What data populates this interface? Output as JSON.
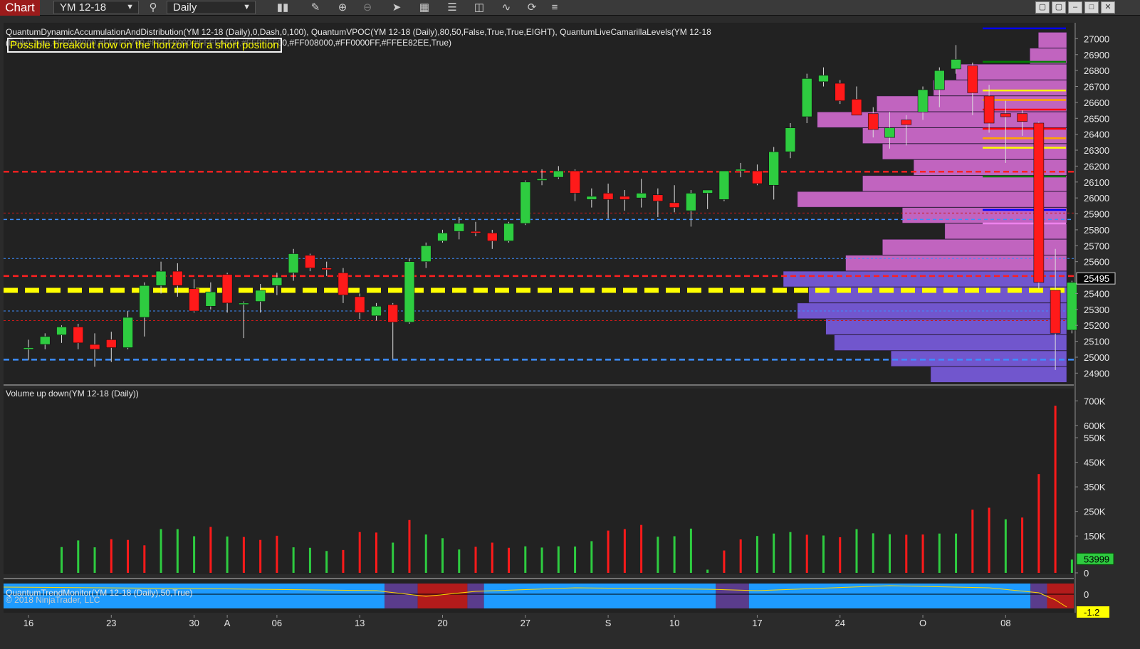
{
  "toolbar": {
    "brand": "Chart",
    "instrument": "YM 12-18",
    "period": "Daily"
  },
  "captions": {
    "price_indicators": "QuantumDynamicAccumulationAndDistribution(YM 12-18 (Daily),0,Dash,0,100), QuantumVPOC(YM 12-18 (Daily),80,50,False,True,True,EIGHT), QuantumLiveCamarillaLevels(YM 12-18",
    "price_indicators_2": "(Daily),True,#FF008000,#FFFFD700,#FFFF0000,#FFFFA500,#FFFFFF00,#FF008000,#FF0000FF,#FFEE82EE,True)",
    "banner": "Possible breakout now on the horizon for a short position",
    "volume_panel": "Volume up down(YM 12-18 (Daily))",
    "trend_panel": "QuantumTrendMonitor(YM 12-18 (Daily),50,True)",
    "copyright": "© 2018 NinjaTrader, LLC"
  },
  "colors": {
    "background": "#222222",
    "up": "#2ecc40",
    "down": "#ff1a1a",
    "vpoc_upper": "#d36bd0",
    "vpoc_lower": "#7a5ce0",
    "support_yellow": "#ffff00",
    "trend_blue": "#1e9bff",
    "trend_purple": "#5a3c8c",
    "trend_red": "#b31b1b"
  },
  "chart_data": {
    "type": "candlestick",
    "instrument": "YM 12-18",
    "timeframe": "Daily",
    "ylim": [
      24830,
      27100
    ],
    "y_ticks": [
      27000,
      26900,
      26800,
      26700,
      26600,
      26500,
      26400,
      26300,
      26200,
      26100,
      26000,
      25900,
      25800,
      25700,
      25600,
      25400,
      25300,
      25200,
      25100,
      25000,
      24900
    ],
    "x_ticks": [
      "16",
      "23",
      "30",
      "A",
      "06",
      "13",
      "20",
      "27",
      "S",
      "10",
      "17",
      "24",
      "O",
      "08"
    ],
    "x_tick_bars": [
      0,
      5,
      10,
      12,
      15,
      20,
      25,
      30,
      35,
      39,
      44,
      49,
      54,
      59
    ],
    "last_price": 25495,
    "candles": [
      {
        "o": 25050,
        "h": 25110,
        "l": 24980,
        "c": 25060
      },
      {
        "o": 25080,
        "h": 25150,
        "l": 25050,
        "c": 25130
      },
      {
        "o": 25140,
        "h": 25200,
        "l": 25090,
        "c": 25190
      },
      {
        "o": 25190,
        "h": 25210,
        "l": 25050,
        "c": 25090
      },
      {
        "o": 25080,
        "h": 25150,
        "l": 24940,
        "c": 25050
      },
      {
        "o": 25110,
        "h": 25160,
        "l": 24970,
        "c": 25060
      },
      {
        "o": 25060,
        "h": 25290,
        "l": 25050,
        "c": 25250
      },
      {
        "o": 25250,
        "h": 25470,
        "l": 25130,
        "c": 25450
      },
      {
        "o": 25450,
        "h": 25600,
        "l": 25400,
        "c": 25540
      },
      {
        "o": 25540,
        "h": 25590,
        "l": 25380,
        "c": 25450
      },
      {
        "o": 25430,
        "h": 25490,
        "l": 25280,
        "c": 25290
      },
      {
        "o": 25320,
        "h": 25470,
        "l": 25300,
        "c": 25410
      },
      {
        "o": 25520,
        "h": 25530,
        "l": 25280,
        "c": 25340
      },
      {
        "o": 25340,
        "h": 25350,
        "l": 25120,
        "c": 25340
      },
      {
        "o": 25350,
        "h": 25460,
        "l": 25280,
        "c": 25420
      },
      {
        "o": 25450,
        "h": 25530,
        "l": 25390,
        "c": 25500
      },
      {
        "o": 25530,
        "h": 25680,
        "l": 25480,
        "c": 25650
      },
      {
        "o": 25640,
        "h": 25650,
        "l": 25540,
        "c": 25560
      },
      {
        "o": 25560,
        "h": 25600,
        "l": 25510,
        "c": 25550
      },
      {
        "o": 25530,
        "h": 25560,
        "l": 25340,
        "c": 25390
      },
      {
        "o": 25380,
        "h": 25400,
        "l": 25240,
        "c": 25280
      },
      {
        "o": 25260,
        "h": 25340,
        "l": 25230,
        "c": 25320
      },
      {
        "o": 25330,
        "h": 25340,
        "l": 24990,
        "c": 25220
      },
      {
        "o": 25220,
        "h": 25620,
        "l": 25210,
        "c": 25600
      },
      {
        "o": 25600,
        "h": 25720,
        "l": 25560,
        "c": 25700
      },
      {
        "o": 25730,
        "h": 25800,
        "l": 25720,
        "c": 25780
      },
      {
        "o": 25790,
        "h": 25880,
        "l": 25740,
        "c": 25840
      },
      {
        "o": 25790,
        "h": 25850,
        "l": 25760,
        "c": 25780
      },
      {
        "o": 25780,
        "h": 25800,
        "l": 25680,
        "c": 25730
      },
      {
        "o": 25730,
        "h": 25850,
        "l": 25720,
        "c": 25840
      },
      {
        "o": 25840,
        "h": 26110,
        "l": 25830,
        "c": 26100
      },
      {
        "o": 26110,
        "h": 26180,
        "l": 26080,
        "c": 26120
      },
      {
        "o": 26130,
        "h": 26200,
        "l": 26120,
        "c": 26170
      },
      {
        "o": 26170,
        "h": 26180,
        "l": 25980,
        "c": 26030
      },
      {
        "o": 25990,
        "h": 26060,
        "l": 25940,
        "c": 26010
      },
      {
        "o": 26030,
        "h": 26090,
        "l": 25870,
        "c": 25990
      },
      {
        "o": 26010,
        "h": 26050,
        "l": 25920,
        "c": 25990
      },
      {
        "o": 26000,
        "h": 26120,
        "l": 25940,
        "c": 26030
      },
      {
        "o": 26020,
        "h": 26060,
        "l": 25880,
        "c": 25980
      },
      {
        "o": 25970,
        "h": 26080,
        "l": 25910,
        "c": 25940
      },
      {
        "o": 25920,
        "h": 26050,
        "l": 25820,
        "c": 26030
      },
      {
        "o": 26030,
        "h": 26050,
        "l": 25930,
        "c": 26050
      },
      {
        "o": 25990,
        "h": 26170,
        "l": 25980,
        "c": 26170
      },
      {
        "o": 26170,
        "h": 26220,
        "l": 26130,
        "c": 26180
      },
      {
        "o": 26170,
        "h": 26210,
        "l": 26080,
        "c": 26090
      },
      {
        "o": 26080,
        "h": 26320,
        "l": 25990,
        "c": 26290
      },
      {
        "o": 26290,
        "h": 26470,
        "l": 26250,
        "c": 26440
      },
      {
        "o": 26510,
        "h": 26780,
        "l": 26470,
        "c": 26750
      },
      {
        "o": 26730,
        "h": 26820,
        "l": 26700,
        "c": 26770
      },
      {
        "o": 26720,
        "h": 26740,
        "l": 26590,
        "c": 26610
      },
      {
        "o": 26620,
        "h": 26700,
        "l": 26520,
        "c": 26520
      },
      {
        "o": 26530,
        "h": 26570,
        "l": 26380,
        "c": 26430
      },
      {
        "o": 26380,
        "h": 26540,
        "l": 26310,
        "c": 26440
      },
      {
        "o": 26490,
        "h": 26520,
        "l": 26330,
        "c": 26460
      },
      {
        "o": 26540,
        "h": 26700,
        "l": 26490,
        "c": 26680
      },
      {
        "o": 26680,
        "h": 26820,
        "l": 26570,
        "c": 26800
      },
      {
        "o": 26810,
        "h": 26960,
        "l": 26780,
        "c": 26870
      },
      {
        "o": 26830,
        "h": 26850,
        "l": 26520,
        "c": 26660
      },
      {
        "o": 26640,
        "h": 26710,
        "l": 26410,
        "c": 26470
      },
      {
        "o": 26530,
        "h": 26610,
        "l": 26220,
        "c": 26510
      },
      {
        "o": 26530,
        "h": 26550,
        "l": 26390,
        "c": 26480
      },
      {
        "o": 26470,
        "h": 26480,
        "l": 25430,
        "c": 25470
      },
      {
        "o": 25420,
        "h": 25680,
        "l": 24920,
        "c": 25150
      },
      {
        "o": 25170,
        "h": 25480,
        "l": 25150,
        "c": 25470
      }
    ],
    "horizontal_levels": [
      {
        "price": 26165,
        "color": "#ff2020",
        "style": "dash-thick"
      },
      {
        "price": 25905,
        "color": "#cc1a1a",
        "style": "dotted"
      },
      {
        "price": 25865,
        "color": "#3d8eff",
        "style": "dash"
      },
      {
        "price": 25620,
        "color": "#3d8eff",
        "style": "dotted"
      },
      {
        "price": 25510,
        "color": "#ff2020",
        "style": "dash-thick"
      },
      {
        "price": 25420,
        "color": "#ffff00",
        "style": "dash-heavy"
      },
      {
        "price": 25290,
        "color": "#3d8eff",
        "style": "dotted"
      },
      {
        "price": 25230,
        "color": "#cc1a1a",
        "style": "dotted"
      },
      {
        "price": 24985,
        "color": "#3d8eff",
        "style": "dash-thick"
      }
    ],
    "camarilla_levels": [
      {
        "price": 27065,
        "color": "#0000ff"
      },
      {
        "price": 26855,
        "color": "#008000"
      },
      {
        "price": 26675,
        "color": "#ffff00"
      },
      {
        "price": 26615,
        "color": "#ffa500"
      },
      {
        "price": 26555,
        "color": "#ff0000"
      },
      {
        "price": 26435,
        "color": "#ff0000"
      },
      {
        "price": 26375,
        "color": "#ffa500"
      },
      {
        "price": 26315,
        "color": "#ffff00"
      },
      {
        "price": 26135,
        "color": "#008000"
      },
      {
        "price": 25925,
        "color": "#0000ff"
      },
      {
        "price": 25840,
        "color": "#ee82ee"
      }
    ],
    "volume_profile": [
      {
        "price": 26990,
        "width": 0.1
      },
      {
        "price": 26890,
        "width": 0.13
      },
      {
        "price": 26790,
        "width": 0.39
      },
      {
        "price": 26690,
        "width": 0.47
      },
      {
        "price": 26590,
        "width": 0.67
      },
      {
        "price": 26490,
        "width": 0.88
      },
      {
        "price": 26390,
        "width": 0.72
      },
      {
        "price": 26290,
        "width": 0.65
      },
      {
        "price": 26190,
        "width": 0.54
      },
      {
        "price": 26090,
        "width": 0.72
      },
      {
        "price": 25990,
        "width": 0.95
      },
      {
        "price": 25890,
        "width": 0.58
      },
      {
        "price": 25790,
        "width": 0.43
      },
      {
        "price": 25690,
        "width": 0.65
      },
      {
        "price": 25590,
        "width": 0.78
      },
      {
        "price": 25490,
        "width": 1.0
      },
      {
        "price": 25390,
        "width": 0.91
      },
      {
        "price": 25290,
        "width": 0.95
      },
      {
        "price": 25190,
        "width": 0.85
      },
      {
        "price": 25090,
        "width": 0.82
      },
      {
        "price": 24990,
        "width": 0.62
      },
      {
        "price": 24890,
        "width": 0.48
      }
    ],
    "volume": {
      "ticks": [
        "700K",
        "600K",
        "550K",
        "450K",
        "350K",
        "250K",
        "150K",
        "0"
      ],
      "tick_values": [
        700000,
        600000,
        550000,
        450000,
        350000,
        250000,
        150000,
        0
      ],
      "last_label": "53999",
      "values": [
        105000,
        132000,
        104000,
        137000,
        134000,
        112000,
        178000,
        178000,
        149000,
        187000,
        148000,
        146000,
        134000,
        151000,
        104000,
        102000,
        89000,
        93000,
        166000,
        164000,
        123000,
        215000,
        156000,
        141000,
        95000,
        106000,
        123000,
        102000,
        108000,
        103000,
        108000,
        107000,
        129000,
        172000,
        178000,
        195000,
        147000,
        149000,
        180000,
        13000,
        91000,
        136000,
        150000,
        160000,
        166000,
        155000,
        152000,
        145000,
        178000,
        161000,
        157000,
        155000,
        156000,
        160000,
        160000,
        257000,
        265000,
        218000,
        225000,
        402000,
        680000,
        54000
      ],
      "colors": [
        "up",
        "up",
        "up",
        "down",
        "down",
        "down",
        "up",
        "up",
        "up",
        "down",
        "up",
        "down",
        "down",
        "down",
        "up",
        "up",
        "up",
        "down",
        "down",
        "down",
        "up",
        "down",
        "up",
        "up",
        "up",
        "down",
        "down",
        "down",
        "up",
        "up",
        "up",
        "up",
        "up",
        "down",
        "down",
        "down",
        "up",
        "up",
        "up",
        "up",
        "down",
        "down",
        "up",
        "up",
        "up",
        "down",
        "up",
        "down",
        "up",
        "up",
        "up",
        "down",
        "down",
        "up",
        "up",
        "down",
        "down",
        "up",
        "down",
        "down",
        "down",
        "up"
      ]
    },
    "trend": {
      "axis_top": "0",
      "axis_bottom": "-1.2",
      "segments": [
        {
          "from": 0,
          "to": 22,
          "color": "blue"
        },
        {
          "from": 22,
          "to": 24,
          "color": "purple"
        },
        {
          "from": 24,
          "to": 27,
          "color": "red"
        },
        {
          "from": 27,
          "to": 28,
          "color": "purple"
        },
        {
          "from": 28,
          "to": 42,
          "color": "blue"
        },
        {
          "from": 42,
          "to": 44,
          "color": "purple"
        },
        {
          "from": 44,
          "to": 61,
          "color": "blue"
        },
        {
          "from": 61,
          "to": 62,
          "color": "purple"
        },
        {
          "from": 62,
          "to": 64,
          "color": "red"
        }
      ]
    }
  }
}
